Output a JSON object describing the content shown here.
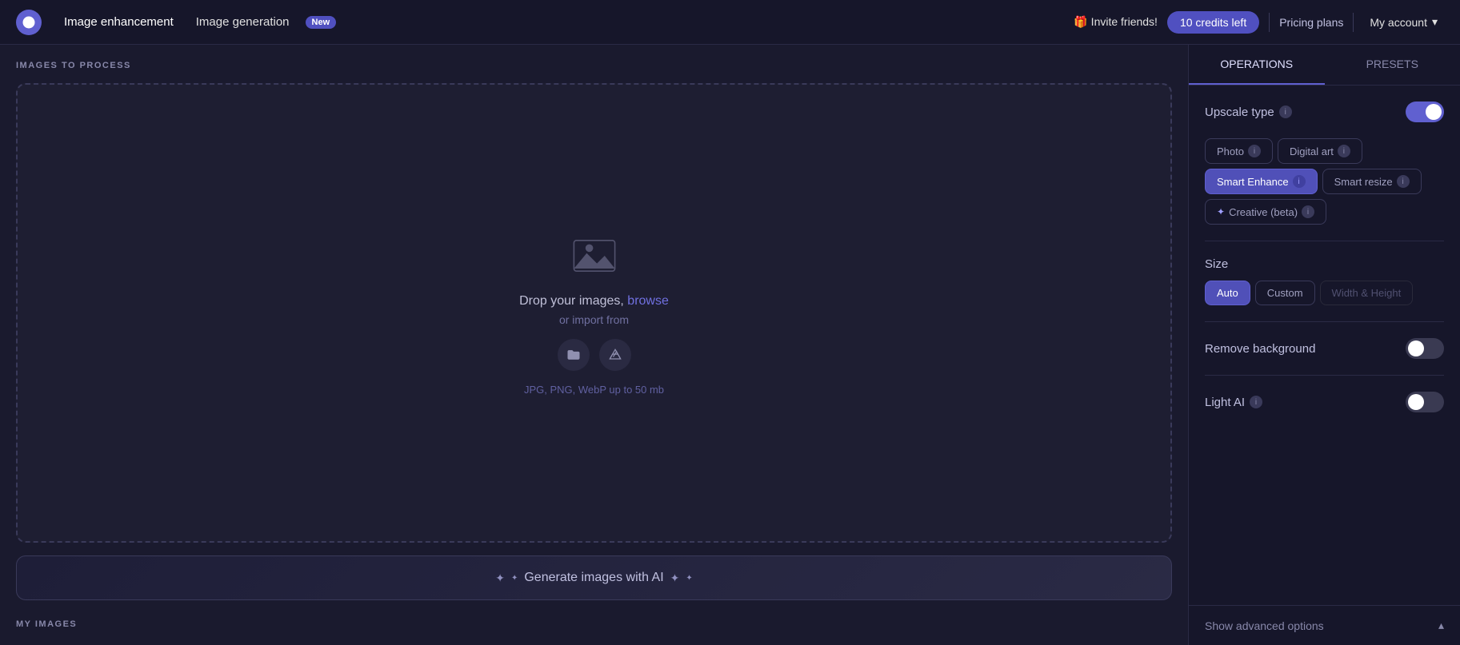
{
  "header": {
    "logo_alt": "App logo",
    "nav": [
      {
        "id": "image-enhancement",
        "label": "Image enhancement",
        "active": true
      },
      {
        "id": "image-generation",
        "label": "Image generation",
        "badge": "New"
      }
    ],
    "invite_btn": "🎁 Invite friends!",
    "credits_btn": "10 credits left",
    "divider": true,
    "pricing_label": "Pricing plans",
    "my_account_label": "My account"
  },
  "left_panel": {
    "images_section_title": "IMAGES TO PROCESS",
    "dropzone": {
      "main_text": "Drop your images, ",
      "browse_link": "browse",
      "or_text": "or import from",
      "file_types": "JPG, PNG, WebP up to 50 mb"
    },
    "generate_btn": "Generate images with AI",
    "my_images_title": "MY IMAGES"
  },
  "right_panel": {
    "tabs": [
      {
        "id": "operations",
        "label": "OPERATIONS",
        "active": true
      },
      {
        "id": "presets",
        "label": "PRESETS",
        "active": false
      }
    ],
    "upscale_type": {
      "label": "Upscale type",
      "toggle_on": true,
      "options": [
        {
          "id": "photo",
          "label": "Photo",
          "active": false
        },
        {
          "id": "digital-art",
          "label": "Digital art",
          "active": false
        },
        {
          "id": "smart-enhance",
          "label": "Smart Enhance",
          "active": true
        },
        {
          "id": "smart-resize",
          "label": "Smart resize",
          "active": false
        },
        {
          "id": "creative-beta",
          "label": "Creative (beta)",
          "active": false,
          "sparkle": true
        }
      ]
    },
    "size": {
      "label": "Size",
      "options": [
        {
          "id": "auto",
          "label": "Auto",
          "active": true
        },
        {
          "id": "custom",
          "label": "Custom",
          "active": false
        },
        {
          "id": "width-height",
          "label": "Width & Height",
          "active": false,
          "disabled": true
        }
      ]
    },
    "remove_background": {
      "label": "Remove background",
      "toggle_on": false
    },
    "light_ai": {
      "label": "Light AI",
      "toggle_on": false
    },
    "show_advanced": "Show advanced options"
  },
  "icons": {
    "chevron_down": "▾",
    "chevron_up": "▴",
    "info": "i",
    "sparkle": "✦",
    "folder": "📁",
    "drive": "▲"
  }
}
